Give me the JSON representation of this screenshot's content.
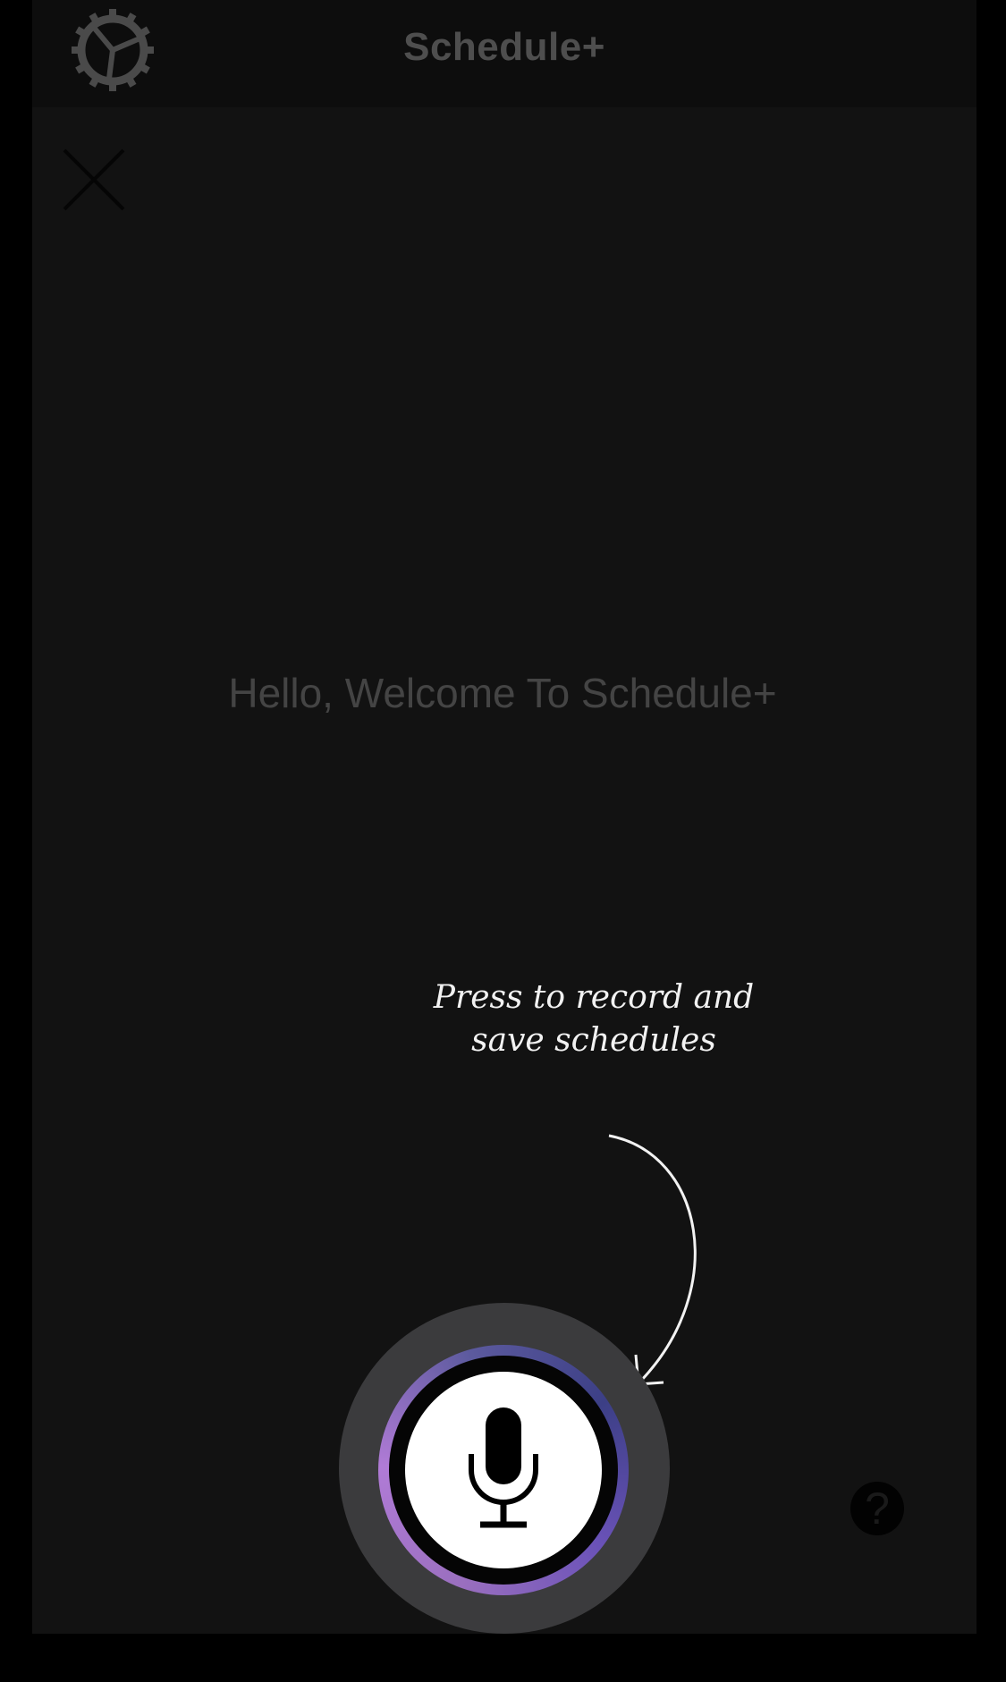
{
  "app": {
    "title": "Schedule+"
  },
  "icons": {
    "settings": "gear-icon",
    "close": "close-icon",
    "microphone": "microphone-icon",
    "help": "question-icon",
    "hint_arrow": "curved-arrow-icon"
  },
  "main": {
    "welcome": "Hello, Welcome To Schedule+"
  },
  "hint": {
    "line1": "Press to record and",
    "line2": "save schedules"
  },
  "help": {
    "label": "?"
  },
  "colors": {
    "background": "#121212",
    "nav_background": "#0d0d0d",
    "title_text": "#4e4e4e",
    "welcome_text": "#444444",
    "hint_text": "#f2f2f2",
    "ring_accent": "#9a6fbf",
    "ring_secondary": "#3c3f86",
    "mic_button": "#ffffff"
  }
}
